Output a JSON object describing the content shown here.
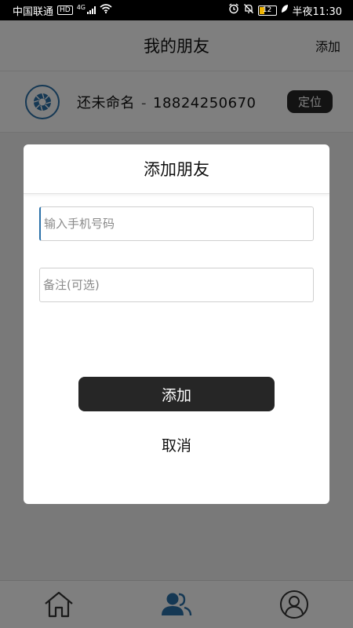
{
  "status_bar": {
    "carrier": "中国联通",
    "hd": "HD",
    "net": "4G",
    "battery": "12",
    "time_label": "半夜11:30"
  },
  "header": {
    "title": "我的朋友",
    "action": "添加"
  },
  "friends": [
    {
      "name": "还未命名",
      "separator": "-",
      "phone": "18824250670",
      "locate_label": "定位"
    }
  ],
  "dialog": {
    "title": "添加朋友",
    "phone_placeholder": "输入手机号码",
    "note_placeholder": "备注(可选)",
    "add_label": "添加",
    "cancel_label": "取消"
  },
  "nav": {
    "items": [
      {
        "icon": "home-icon"
      },
      {
        "icon": "friends-icon",
        "active": true
      },
      {
        "icon": "profile-icon"
      }
    ]
  },
  "colors": {
    "accent": "#2a70a8",
    "dark_button": "#262626",
    "overlay": "rgba(0,0,0,0.5)"
  }
}
